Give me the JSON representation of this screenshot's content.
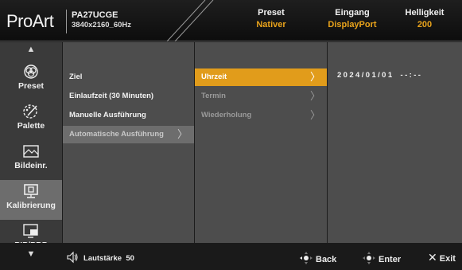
{
  "header": {
    "brand": "ProArt",
    "model": "PA27UCGE",
    "resolution": "3840x2160_60Hz",
    "preset": {
      "label": "Preset",
      "value": "Nativer"
    },
    "input": {
      "label": "Eingang",
      "value": "DisplayPort"
    },
    "brightness": {
      "label": "Helligkeit",
      "value": "200"
    }
  },
  "sidebar": {
    "items": [
      {
        "label": "Preset",
        "icon": "preset-icon"
      },
      {
        "label": "Palette",
        "icon": "palette-icon"
      },
      {
        "label": "Bildeinr.",
        "icon": "image-settings-icon"
      },
      {
        "label": "Kalibrierung",
        "icon": "calibration-icon",
        "active": true
      },
      {
        "label": "PIP/PBP",
        "icon": "pip-pbp-icon"
      }
    ]
  },
  "menu1": {
    "items": [
      {
        "label": "Ziel"
      },
      {
        "label": "Einlaufzeit (30 Minuten)"
      },
      {
        "label": "Manuelle Ausführung"
      },
      {
        "label": "Automatische Ausführung",
        "selected": true
      }
    ]
  },
  "menu2": {
    "items": [
      {
        "label": "Uhrzeit",
        "selected": true
      },
      {
        "label": "Termin",
        "disabled": true
      },
      {
        "label": "Wiederholung",
        "disabled": true
      }
    ]
  },
  "detail": {
    "date": "2024/01/01",
    "time": "--:--"
  },
  "footer": {
    "volume_label": "Lautstärke",
    "volume_value": "50",
    "back": "Back",
    "enter": "Enter",
    "exit": "Exit"
  },
  "colors": {
    "accent": "#e19c1b",
    "panel": "#4d4d4d",
    "selected_gray": "#6d6d6d"
  }
}
